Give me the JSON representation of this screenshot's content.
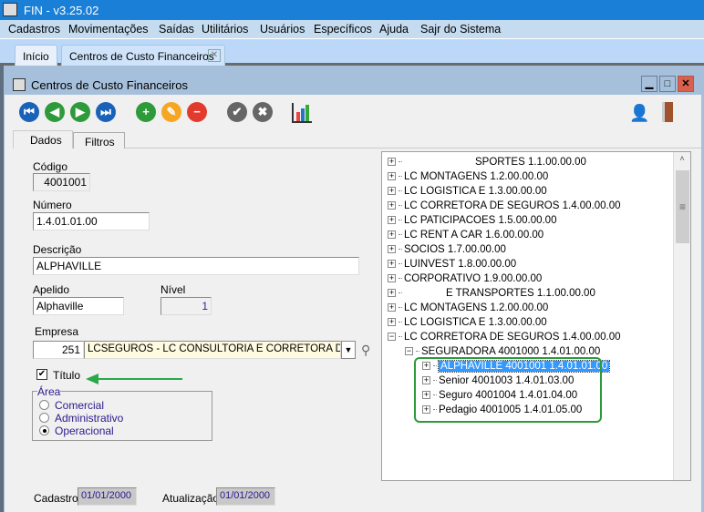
{
  "app": {
    "title": "FIN - v3.25.02"
  },
  "menu": [
    "Cadastros",
    "Movimentações",
    "Saídas",
    "Utilitários",
    "Usuários",
    "Específicos",
    "Ajuda",
    "Sajr do Sistema"
  ],
  "tabs": {
    "home": "Início",
    "active": "Centros de Custo Financeiros"
  },
  "window": {
    "title": "Centros de Custo Financeiros"
  },
  "toolbar": {
    "icons": [
      "first-icon",
      "previous-icon",
      "next-icon",
      "last-icon",
      "add-icon",
      "edit-icon",
      "delete-icon",
      "confirm-icon",
      "cancel-icon",
      "report-icon",
      "user-security-icon",
      "exit-door-icon"
    ]
  },
  "form_tabs": [
    "Dados",
    "Filtros"
  ],
  "form": {
    "codigo_label": "Código",
    "codigo": "4001001",
    "numero_label": "Número",
    "numero": "1.4.01.01.00",
    "descricao_label": "Descrição",
    "descricao": "ALPHAVILLE",
    "apelido_label": "Apelido",
    "apelido": "Alphaville",
    "nivel_label": "Nível",
    "nivel": "1",
    "empresa_label": "Empresa",
    "empresa_code": "251",
    "empresa_name": "LCSEGUROS - LC CONSULTORIA E CORRETORA DE SEGI",
    "titulo_label": "Título",
    "titulo_checked": true,
    "area_label": "Área",
    "area_options": [
      "Comercial",
      "Administrativo",
      "Operacional"
    ],
    "area_selected": "Operacional",
    "cadastro_label": "Cadastro",
    "cadastro": "01/01/2000",
    "atualizacao_label": "Atualização",
    "atualizacao": "01/01/2000"
  },
  "tree": [
    {
      "text": "SPORTES 1.1.00.00.00",
      "level": 0,
      "expanded": false
    },
    {
      "text": "LC MONTAGENS 1.2.00.00.00",
      "level": 0,
      "expanded": false
    },
    {
      "text": "LC LOGISTICA E  1.3.00.00.00",
      "level": 0,
      "expanded": false
    },
    {
      "text": "LC CORRETORA DE SEGUROS 1.4.00.00.00",
      "level": 0,
      "expanded": false
    },
    {
      "text": "LC PATICIPACOES 1.5.00.00.00",
      "level": 0,
      "expanded": false
    },
    {
      "text": "LC RENT A CAR 1.6.00.00.00",
      "level": 0,
      "expanded": false
    },
    {
      "text": "SOCIOS 1.7.00.00.00",
      "level": 0,
      "expanded": false
    },
    {
      "text": "LUINVEST 1.8.00.00.00",
      "level": 0,
      "expanded": false
    },
    {
      "text": "CORPORATIVO 1.9.00.00.00",
      "level": 0,
      "expanded": false
    },
    {
      "text": "E TRANSPORTES 1.1.00.00.00",
      "level": 0,
      "expanded": false
    },
    {
      "text": "LC MONTAGENS 1.2.00.00.00",
      "level": 0,
      "expanded": false
    },
    {
      "text": "LC LOGISTICA E  1.3.00.00.00",
      "level": 0,
      "expanded": false
    },
    {
      "text": "LC CORRETORA DE SEGUROS 1.4.00.00.00",
      "level": 0,
      "expanded": true
    },
    {
      "text": "SEGURADORA 4001000 1.4.01.00.00",
      "level": 1,
      "expanded": true
    },
    {
      "text": "ALPHAVILLE 4001001 1.4.01.01.00",
      "level": 2,
      "expanded": false,
      "selected": true
    },
    {
      "text": "Senior 4001003 1.4.01.03.00",
      "level": 2,
      "expanded": false
    },
    {
      "text": "Seguro 4001004 1.4.01.04.00",
      "level": 2,
      "expanded": false
    },
    {
      "text": "Pedagio 4001005 1.4.01.05.00",
      "level": 2,
      "expanded": false
    }
  ],
  "colors": {
    "titlebar": "#1a7fd6",
    "selection": "#3399ff",
    "highlight_box": "#2e9a3a",
    "arrow": "#2aa84a"
  }
}
